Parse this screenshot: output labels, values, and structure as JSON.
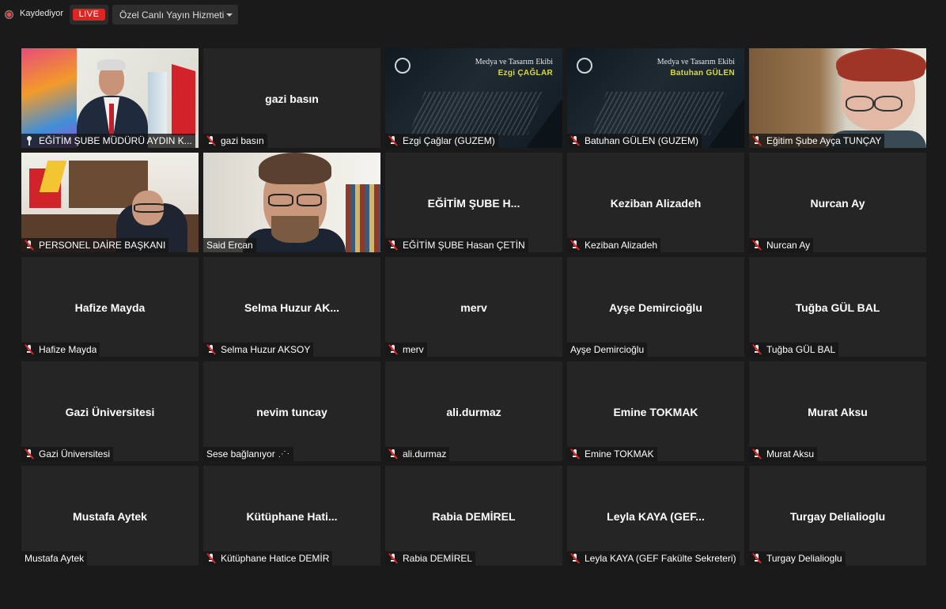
{
  "topbar": {
    "recording_label": "Kaydediyor",
    "live_label": "LIVE",
    "stream_menu_label": "Özel Canlı Yayın Hizmeti"
  },
  "colors": {
    "background": "#1a1a1a",
    "tile": "#252525",
    "active_speaker_border": "#e6ef6e",
    "live_badge": "#e02424",
    "muted_mic": "#e02424"
  },
  "participants": [
    {
      "center": "",
      "label": "EĞİTİM ŞUBE MÜDÜRÜ AYDIN K...",
      "icon": "pin-icon",
      "video": "camera"
    },
    {
      "center": "gazi basın",
      "label": "gazi basın",
      "icon": "mic-muted-icon"
    },
    {
      "center": "",
      "label": "Ezgi Çağlar (GUZEM)",
      "icon": "mic-muted-icon",
      "video": "branded",
      "brand_team": "Medya ve Tasarım Ekibi",
      "brand_person": "Ezgi ÇAĞLAR"
    },
    {
      "center": "",
      "label": "Batuhan GÜLEN (GUZEM)",
      "icon": "mic-muted-icon",
      "video": "branded",
      "brand_team": "Medya ve Tasarım Ekibi",
      "brand_person": "Batuhan GÜLEN"
    },
    {
      "center": "",
      "label": "Eğitim Şube Ayça TUNÇAY",
      "icon": "mic-muted-icon",
      "video": "camera"
    },
    {
      "center": "",
      "label": "PERSONEL DAİRE BAŞKANI",
      "icon": "mic-muted-icon",
      "video": "camera"
    },
    {
      "center": "",
      "label": "Said Ercan",
      "icon": "",
      "video": "camera"
    },
    {
      "center": "EĞİTİM ŞUBE H...",
      "label": "EĞİTİM ŞUBE Hasan ÇETİN",
      "icon": "mic-muted-icon"
    },
    {
      "center": "Keziban Alizadeh",
      "label": "Keziban Alizadeh",
      "icon": "mic-muted-icon"
    },
    {
      "center": "Nurcan Ay",
      "label": "Nurcan Ay",
      "icon": "mic-muted-icon"
    },
    {
      "center": "Hafize Mayda",
      "label": "Hafize Mayda",
      "icon": "mic-muted-icon"
    },
    {
      "center": "Selma  Huzur  AK...",
      "label": "Selma Huzur AKSOY",
      "icon": "mic-muted-icon"
    },
    {
      "center": "merv",
      "label": "merv",
      "icon": "mic-muted-icon"
    },
    {
      "center": "Ayşe Demircioğlu",
      "label": "Ayşe Demircioğlu",
      "icon": ""
    },
    {
      "center": "Tuğba GÜL BAL",
      "label": "Tuğba GÜL BAL",
      "icon": "mic-muted-icon"
    },
    {
      "center": "Gazi Üniversitesi",
      "label": "Gazi Üniversitesi",
      "icon": "mic-muted-icon"
    },
    {
      "center": "nevim tuncay",
      "label": "Sese bağlanıyor",
      "icon": "",
      "connecting": true
    },
    {
      "center": "ali.durmaz",
      "label": "ali.durmaz",
      "icon": "mic-muted-icon"
    },
    {
      "center": "Emine TOKMAK",
      "label": "Emine TOKMAK",
      "icon": "mic-muted-icon"
    },
    {
      "center": "Murat Aksu",
      "label": "Murat Aksu",
      "icon": "mic-muted-icon"
    },
    {
      "center": "Mustafa Aytek",
      "label": "Mustafa Aytek",
      "icon": ""
    },
    {
      "center": "Kütüphane  Hati...",
      "label": "Kütüphane Hatice DEMİR",
      "icon": "mic-muted-icon"
    },
    {
      "center": "Rabia DEMİREL",
      "label": "Rabia DEMİREL",
      "icon": "mic-muted-icon"
    },
    {
      "center": "Leyla KAYA  (GEF...",
      "label": "Leyla KAYA (GEF Fakülte Sekreteri)",
      "icon": "mic-muted-icon"
    },
    {
      "center": "Turgay Delialioglu",
      "label": "Turgay Delialioglu",
      "icon": "mic-muted-icon"
    }
  ]
}
